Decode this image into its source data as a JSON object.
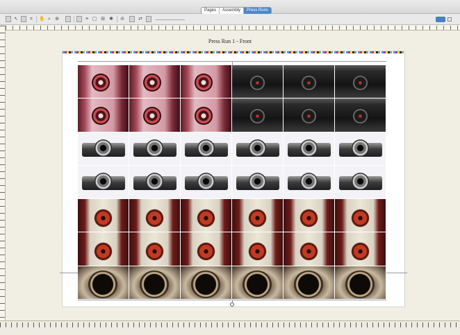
{
  "window": {
    "segmented": [
      {
        "label": "Pages",
        "active": false
      },
      {
        "label": "Assembly",
        "active": false
      },
      {
        "label": "Press Runs",
        "active": true
      }
    ]
  },
  "toolbar": {
    "tools": [
      "select-tool",
      "move-tool",
      "rotate-tool",
      "crop-tool",
      "hand-tool",
      "zoom-tool",
      "marks-tool",
      "info-tool",
      "proof-tool",
      "layers-tool",
      "grid-tool",
      "settings-tool"
    ]
  },
  "canvas": {
    "sheet_title": "Press Run 1 - Front",
    "slug": "",
    "grid": {
      "columns": 6,
      "rows": [
        "pink-black",
        "pink-black",
        "white",
        "white",
        "brown",
        "brown",
        "dial"
      ]
    },
    "accent_colors": {
      "active_tab": "#4f86c6",
      "canvas_bg": "#f1efe4",
      "sheet_bg": "#ffffff"
    }
  }
}
